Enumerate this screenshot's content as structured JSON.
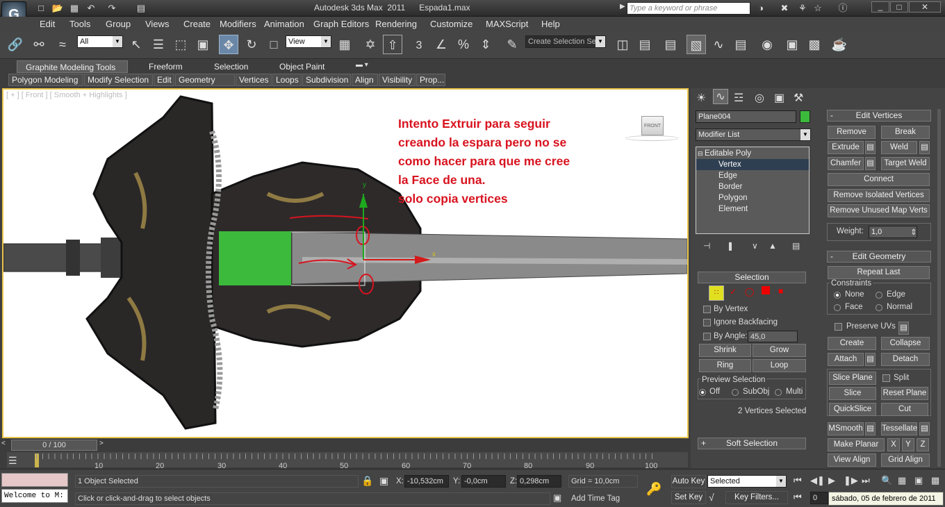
{
  "title_bar": {
    "title": "Autodesk 3ds Max  2011      Espada1.max",
    "search_placeholder": "Type a keyword or phrase"
  },
  "menu": [
    "Edit",
    "Tools",
    "Group",
    "Views",
    "Create",
    "Modifiers",
    "Animation",
    "Graph Editors",
    "Rendering",
    "Customize",
    "MAXScript",
    "Help"
  ],
  "main_toolbar": {
    "selection_filter": "All",
    "ref_coord": "View",
    "named_selection": "Create Selection Se",
    "angle_snap": "3",
    "percent_snap": "%"
  },
  "ribbon": {
    "tabs": [
      "Graphite Modeling Tools",
      "Freeform",
      "Selection",
      "Object Paint"
    ],
    "subtabs": [
      "Polygon Modeling",
      "Modify Selection",
      "Edit",
      "Geometry (All)",
      "Vertices",
      "Loops",
      "Subdivision",
      "Align",
      "Visibility",
      "Prop..."
    ]
  },
  "viewport": {
    "label": "[ + ] [ Front ] [ Smooth + Highlights ]",
    "viewcube_label": "FRONT",
    "gizmo_y": "y",
    "gizmo_x": "x",
    "annotation": [
      "Intento Extruir para seguir",
      "creando la espara pero no se",
      "como hacer para que me cree",
      "la Face de una.",
      "solo copia vertices"
    ],
    "colors": {
      "annotation": "#d8131f",
      "selection_green": "#3cba3c",
      "frame": "#e9c54a"
    }
  },
  "command_panel": {
    "object_name": "Plane004",
    "modifier_list": "Modifier List",
    "stack": [
      "Editable Poly",
      "Vertex",
      "Edge",
      "Border",
      "Polygon",
      "Element"
    ],
    "selection": {
      "header": "Selection",
      "by_vertex": "By Vertex",
      "ignore_backfacing": "Ignore Backfacing",
      "by_angle": "By Angle:",
      "angle_value": "45,0",
      "shrink": "Shrink",
      "grow": "Grow",
      "ring": "Ring",
      "loop": "Loop",
      "preview_label": "Preview Selection",
      "off": "Off",
      "subobj": "SubObj",
      "multi": "Multi",
      "status": "2 Vertices Selected"
    },
    "soft_selection": "Soft Selection",
    "edit_vertices": {
      "header": "Edit Vertices",
      "remove": "Remove",
      "break": "Break",
      "extrude": "Extrude",
      "weld": "Weld",
      "chamfer": "Chamfer",
      "target_weld": "Target Weld",
      "connect": "Connect",
      "remove_isolated": "Remove Isolated Vertices",
      "remove_unused": "Remove Unused Map Verts",
      "weight_label": "Weight:",
      "weight_value": "1,0"
    },
    "edit_geometry": {
      "header": "Edit Geometry",
      "repeat_last": "Repeat Last",
      "constraints": "Constraints",
      "none": "None",
      "edge": "Edge",
      "face": "Face",
      "normal": "Normal",
      "preserve_uvs": "Preserve UVs",
      "create": "Create",
      "collapse": "Collapse",
      "attach": "Attach",
      "detach": "Detach",
      "slice_plane": "Slice Plane",
      "split": "Split",
      "slice": "Slice",
      "reset_plane": "Reset Plane",
      "quickslice": "QuickSlice",
      "cut": "Cut",
      "msmooth": "MSmooth",
      "tessellate": "Tessellate",
      "make_planar": "Make Planar",
      "x": "X",
      "y": "Y",
      "z": "Z",
      "view_align": "View Align",
      "grid_align": "Grid Align"
    }
  },
  "timeline": {
    "frame": "0 / 100",
    "ticks": [
      "10",
      "20",
      "30",
      "40",
      "50",
      "60",
      "70",
      "80",
      "90",
      "100"
    ]
  },
  "status": {
    "objects_selected": "1 Object Selected",
    "prompt": "Click or click-and-drag to select objects",
    "maxscript": "Welcome to M:",
    "x_label": "X:",
    "x": "-10,532cm",
    "y_label": "Y:",
    "y": "-0,0cm",
    "z_label": "Z:",
    "z": "0,298cm",
    "grid": "Grid = 10,0cm",
    "add_time_tag": "Add Time Tag",
    "auto_key": "Auto Key",
    "set_key": "Set Key",
    "key_mode": "Selected",
    "key_filters": "Key Filters...",
    "frame_field": "0",
    "date": "sábado, 05 de febrero de 2011"
  }
}
